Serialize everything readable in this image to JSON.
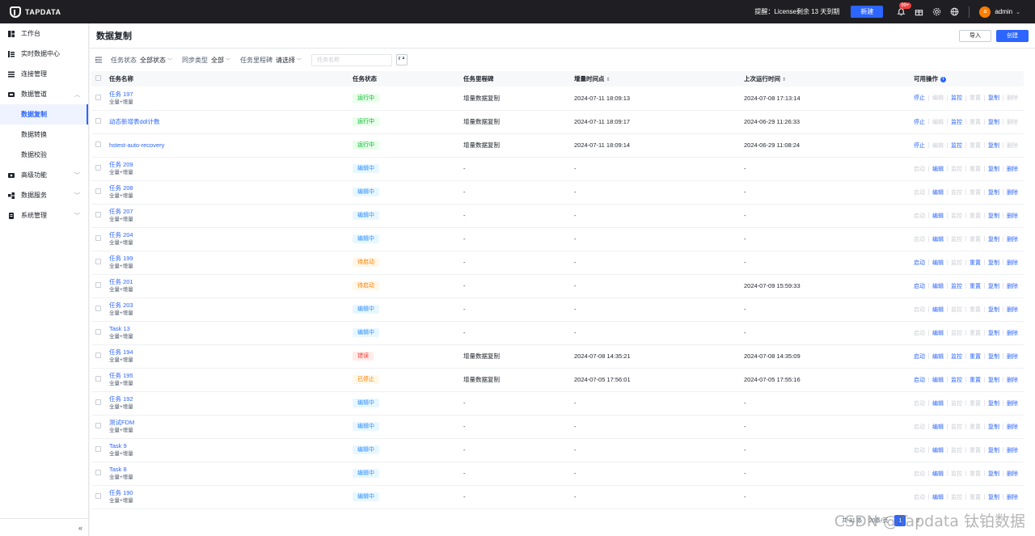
{
  "topbar": {
    "logo_text": "TAPDATA",
    "notice": "提醒：License剩余 13 天到期",
    "new_label": "新建",
    "badge": "99+",
    "user": "admin",
    "avatar_letter": "a"
  },
  "sidebar": {
    "items": [
      {
        "label": "工作台",
        "icon": "dashboard-icon"
      },
      {
        "label": "实时数据中心",
        "icon": "data-center-icon"
      },
      {
        "label": "连接管理",
        "icon": "connection-icon"
      },
      {
        "label": "数据管道",
        "icon": "pipeline-icon"
      },
      {
        "label": "数据复制"
      },
      {
        "label": "数据转换"
      },
      {
        "label": "数据校验"
      },
      {
        "label": "高级功能",
        "icon": "advanced-icon"
      },
      {
        "label": "数据服务",
        "icon": "service-icon"
      },
      {
        "label": "系统管理",
        "icon": "system-icon"
      }
    ]
  },
  "page": {
    "title": "数据复制",
    "import_label": "导入",
    "create_label": "创建"
  },
  "filters": {
    "status_label": "任务状态",
    "status_value": "全部状态",
    "sync_label": "同步类型",
    "sync_value": "全部",
    "milestone_label": "任务里程碑",
    "milestone_value": "请选择",
    "search_placeholder": "任务名称"
  },
  "table": {
    "headers": [
      "任务名称",
      "任务状态",
      "任务里程碑",
      "增量时间点",
      "上次运行时间",
      "可用操作"
    ],
    "ops_labels": [
      "停止",
      "编辑",
      "监控",
      "重置",
      "复制",
      "删除"
    ],
    "rows": [
      {
        "name": "任务 197",
        "type": "全量+增量",
        "status": "运行中",
        "status_class": "st-running",
        "milestone": "增量数据复制",
        "incr": "2024-07-11 18:09:13",
        "last": "2024-07-08 17:13:14",
        "ops": [
          "停止",
          "编辑",
          "监控",
          "重置",
          "复制",
          "删除"
        ],
        "enabled": [
          1,
          0,
          1,
          0,
          1,
          0
        ]
      },
      {
        "name": "动态新增表ddl计数",
        "type": "",
        "status": "运行中",
        "status_class": "st-running",
        "milestone": "增量数据复制",
        "incr": "2024-07-11 18:09:17",
        "last": "2024-06-29 11:26:33",
        "ops": [
          "停止",
          "编辑",
          "监控",
          "重置",
          "复制",
          "删除"
        ],
        "enabled": [
          1,
          0,
          1,
          0,
          1,
          0
        ]
      },
      {
        "name": "hstest-auto-recovery",
        "type": "",
        "status": "运行中",
        "status_class": "st-running",
        "milestone": "增量数据复制",
        "incr": "2024-07-11 18:09:14",
        "last": "2024-06-29 11:08:24",
        "ops": [
          "停止",
          "编辑",
          "监控",
          "重置",
          "复制",
          "删除"
        ],
        "enabled": [
          1,
          0,
          1,
          0,
          1,
          0
        ]
      },
      {
        "name": "任务 209",
        "type": "全量+增量",
        "status": "编辑中",
        "status_class": "st-editing",
        "milestone": "-",
        "incr": "-",
        "last": "-",
        "ops": [
          "启动",
          "编辑",
          "监控",
          "重置",
          "复制",
          "删除"
        ],
        "enabled": [
          0,
          1,
          0,
          0,
          1,
          1
        ]
      },
      {
        "name": "任务 208",
        "type": "全量+增量",
        "status": "编辑中",
        "status_class": "st-editing",
        "milestone": "-",
        "incr": "-",
        "last": "-",
        "ops": [
          "启动",
          "编辑",
          "监控",
          "重置",
          "复制",
          "删除"
        ],
        "enabled": [
          0,
          1,
          0,
          0,
          1,
          1
        ]
      },
      {
        "name": "任务 207",
        "type": "全量+增量",
        "status": "编辑中",
        "status_class": "st-editing",
        "milestone": "-",
        "incr": "-",
        "last": "-",
        "ops": [
          "启动",
          "编辑",
          "监控",
          "重置",
          "复制",
          "删除"
        ],
        "enabled": [
          0,
          1,
          0,
          0,
          1,
          1
        ]
      },
      {
        "name": "任务 204",
        "type": "全量+增量",
        "status": "编辑中",
        "status_class": "st-editing",
        "milestone": "-",
        "incr": "-",
        "last": "-",
        "ops": [
          "启动",
          "编辑",
          "监控",
          "重置",
          "复制",
          "删除"
        ],
        "enabled": [
          0,
          1,
          0,
          0,
          1,
          1
        ]
      },
      {
        "name": "任务 199",
        "type": "全量+增量",
        "status": "待启动",
        "status_class": "st-waiting",
        "milestone": "-",
        "incr": "-",
        "last": "-",
        "ops": [
          "启动",
          "编辑",
          "监控",
          "重置",
          "复制",
          "删除"
        ],
        "enabled": [
          1,
          1,
          0,
          1,
          1,
          1
        ]
      },
      {
        "name": "任务 201",
        "type": "全量+增量",
        "status": "待启动",
        "status_class": "st-waiting",
        "milestone": "-",
        "incr": "-",
        "last": "2024-07-09 15:59:33",
        "ops": [
          "启动",
          "编辑",
          "监控",
          "重置",
          "复制",
          "删除"
        ],
        "enabled": [
          1,
          1,
          1,
          1,
          1,
          1
        ]
      },
      {
        "name": "任务 203",
        "type": "全量+增量",
        "status": "编辑中",
        "status_class": "st-editing",
        "milestone": "-",
        "incr": "-",
        "last": "-",
        "ops": [
          "启动",
          "编辑",
          "监控",
          "重置",
          "复制",
          "删除"
        ],
        "enabled": [
          0,
          1,
          0,
          0,
          1,
          1
        ]
      },
      {
        "name": "Task 13",
        "type": "全量+增量",
        "status": "编辑中",
        "status_class": "st-editing",
        "milestone": "-",
        "incr": "-",
        "last": "-",
        "ops": [
          "启动",
          "编辑",
          "监控",
          "重置",
          "复制",
          "删除"
        ],
        "enabled": [
          0,
          1,
          0,
          0,
          1,
          1
        ]
      },
      {
        "name": "任务 194",
        "type": "全量+增量",
        "status": "错误",
        "status_class": "st-error",
        "milestone": "增量数据复制",
        "incr": "2024-07-08 14:35:21",
        "last": "2024-07-08 14:35:09",
        "ops": [
          "启动",
          "编辑",
          "监控",
          "重置",
          "复制",
          "删除"
        ],
        "enabled": [
          1,
          1,
          1,
          1,
          1,
          1
        ]
      },
      {
        "name": "任务 195",
        "type": "全量+增量",
        "status": "已停止",
        "status_class": "st-stopped",
        "milestone": "增量数据复制",
        "incr": "2024-07-05 17:56:01",
        "last": "2024-07-05 17:55:16",
        "ops": [
          "启动",
          "编辑",
          "监控",
          "重置",
          "复制",
          "删除"
        ],
        "enabled": [
          1,
          1,
          1,
          1,
          1,
          1
        ]
      },
      {
        "name": "任务 192",
        "type": "全量+增量",
        "status": "编辑中",
        "status_class": "st-editing",
        "milestone": "-",
        "incr": "-",
        "last": "-",
        "ops": [
          "启动",
          "编辑",
          "监控",
          "重置",
          "复制",
          "删除"
        ],
        "enabled": [
          0,
          1,
          0,
          0,
          1,
          1
        ]
      },
      {
        "name": "测试FDM",
        "type": "全量+增量",
        "status": "编辑中",
        "status_class": "st-editing",
        "milestone": "-",
        "incr": "-",
        "last": "-",
        "ops": [
          "启动",
          "编辑",
          "监控",
          "重置",
          "复制",
          "删除"
        ],
        "enabled": [
          0,
          1,
          0,
          0,
          1,
          1
        ]
      },
      {
        "name": "Task 9",
        "type": "全量+增量",
        "status": "编辑中",
        "status_class": "st-editing",
        "milestone": "-",
        "incr": "-",
        "last": "-",
        "ops": [
          "启动",
          "编辑",
          "监控",
          "重置",
          "复制",
          "删除"
        ],
        "enabled": [
          0,
          1,
          0,
          0,
          1,
          1
        ]
      },
      {
        "name": "Task 8",
        "type": "全量+增量",
        "status": "编辑中",
        "status_class": "st-editing",
        "milestone": "-",
        "incr": "-",
        "last": "-",
        "ops": [
          "启动",
          "编辑",
          "监控",
          "重置",
          "复制",
          "删除"
        ],
        "enabled": [
          0,
          1,
          0,
          0,
          1,
          1
        ]
      },
      {
        "name": "任务 190",
        "type": "全量+增量",
        "status": "编辑中",
        "status_class": "st-editing",
        "milestone": "-",
        "incr": "-",
        "last": "-",
        "ops": [
          "启动",
          "编辑",
          "监控",
          "重置",
          "复制",
          "删除"
        ],
        "enabled": [
          0,
          1,
          0,
          0,
          1,
          1
        ]
      }
    ]
  },
  "pager": {
    "total": "共 31 条",
    "page_size": "20条/页",
    "page_1": "1",
    "page_2": "2"
  },
  "watermark": "CSDN @Tapdata 钛铂数据",
  "colors": {
    "primary": "#2c65ff",
    "topbar": "#1f1f23"
  }
}
